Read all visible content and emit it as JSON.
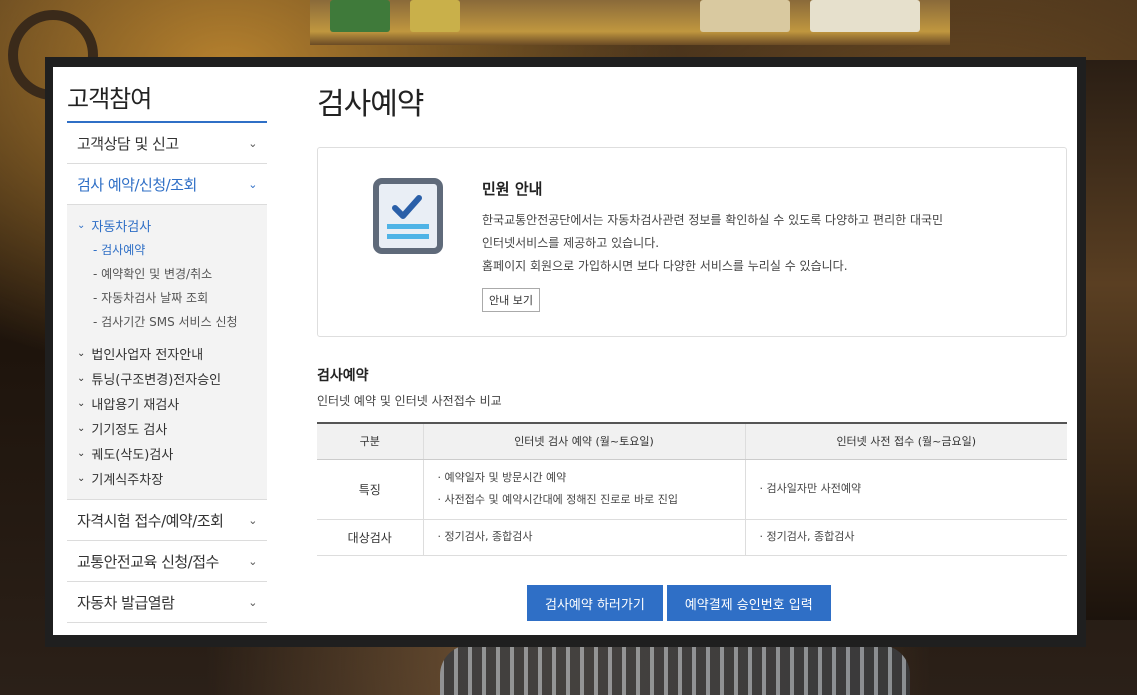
{
  "sidebar": {
    "title": "고객참여",
    "items": [
      {
        "label": "고객상담 및 신고"
      },
      {
        "label": "검사 예약/신청/조회"
      },
      {
        "label": "자격시험 접수/예약/조회"
      },
      {
        "label": "교통안전교육 신청/접수"
      },
      {
        "label": "자동차 발급열람"
      }
    ],
    "submenu": {
      "head": "자동차검사",
      "leaves": [
        "- 검사예약",
        "- 예약확인 및 변경/취소",
        "- 자동차검사 날짜 조회",
        "- 검사기간 SMS 서비스 신청"
      ],
      "groups": [
        "법인사업자 전자안내",
        "튜닝(구조변경)전자승인",
        "내압용기 재검사",
        "기기정도 검사",
        "궤도(삭도)검사",
        "기계식주차장"
      ]
    }
  },
  "main": {
    "title": "검사예약",
    "info": {
      "title": "민원 안내",
      "lines": [
        "한국교통안전공단에서는 자동차검사관련 정보를 확인하실 수 있도록 다양하고 편리한 대국민",
        "인터넷서비스를 제공하고 있습니다.",
        "홈페이지 회원으로 가입하시면 보다 다양한 서비스를 누리실 수 있습니다."
      ],
      "button": "안내 보기",
      "icon": "checklist-document-icon"
    },
    "section_title": "검사예약",
    "section_sub": "인터넷 예약 및 인터넷 사전접수 비교",
    "table": {
      "headers": [
        "구분",
        "인터넷 검사 예약 (월~토요일)",
        "인터넷 사전 접수 (월~금요일)"
      ],
      "rows": [
        {
          "label": "특징",
          "col1": [
            "· 예약일자 및 방문시간 예약",
            "· 사전접수 및 예약시간대에 정해진 진로로 바로 진입"
          ],
          "col2": [
            "· 검사일자만 사전예약"
          ]
        },
        {
          "label": "대상검사",
          "col1": [
            "· 정기검사, 종합검사"
          ],
          "col2": [
            "· 정기검사, 종합검사"
          ]
        }
      ]
    },
    "buttons": [
      "검사예약 하러가기",
      "예약결제 승인번호 입력"
    ]
  },
  "colors": {
    "accent": "#2f6fc6",
    "icon_frame": "#5f6a7a",
    "icon_lines": "#4fb3e6"
  }
}
